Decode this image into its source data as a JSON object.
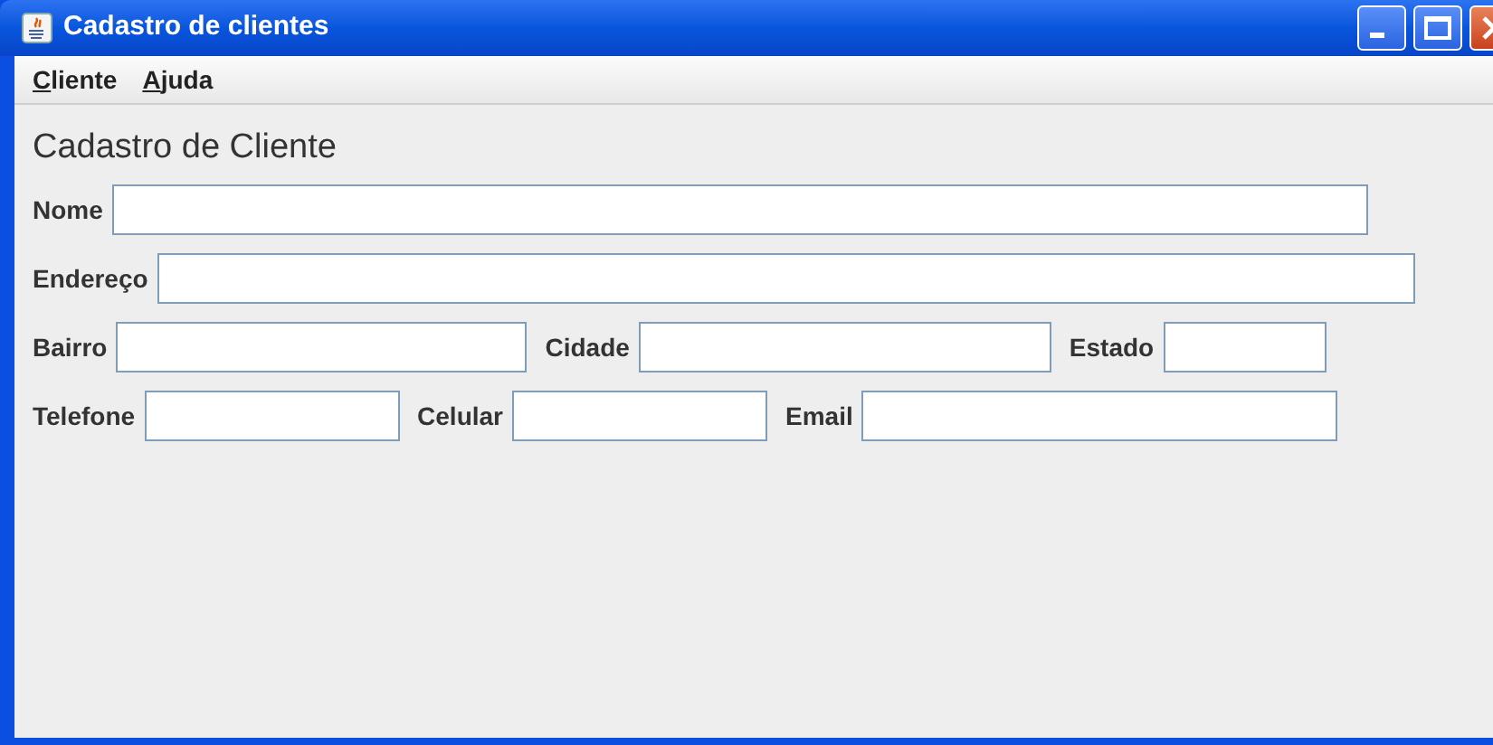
{
  "window": {
    "title": "Cadastro de clientes"
  },
  "menu": [
    {
      "label": "Cliente"
    },
    {
      "label": "Ajuda"
    }
  ],
  "heading": "Cadastro de Cliente",
  "rows": [
    {
      "fields": [
        {
          "label": "Nome"
        }
      ]
    },
    {
      "fields": [
        {
          "label": "Endereço"
        }
      ]
    },
    {
      "fields": [
        {
          "label": "Bairro"
        },
        {
          "label": "Cidade"
        },
        {
          "label": "Estado"
        }
      ]
    },
    {
      "fields": [
        {
          "label": "Telefone"
        },
        {
          "label": "Celular"
        },
        {
          "label": "Email"
        }
      ]
    }
  ]
}
